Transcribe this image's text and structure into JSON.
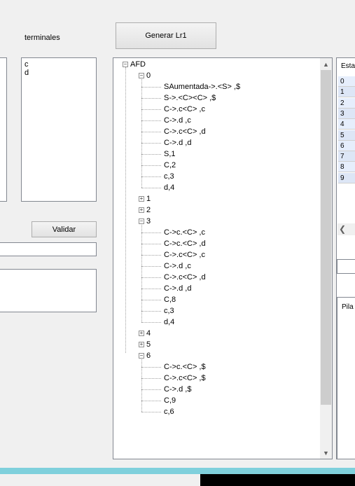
{
  "terminales_label": "terminales",
  "terminales_list": [
    "c",
    "d"
  ],
  "generar_button": "Generar Lr1",
  "validar_button": "Validar",
  "tree": {
    "root": "AFD",
    "nodes": [
      {
        "label": "0",
        "expanded": true,
        "children": [
          "SAumentada->.<S> ,$",
          "S->.<C><C> ,$",
          "C->.c<C> ,c",
          "C->.d ,c",
          "C->.c<C> ,d",
          "C->.d ,d",
          "S,1",
          "C,2",
          "c,3",
          "d,4"
        ]
      },
      {
        "label": "1",
        "expanded": false,
        "children": []
      },
      {
        "label": "2",
        "expanded": false,
        "children": []
      },
      {
        "label": "3",
        "expanded": true,
        "children": [
          "C->c.<C> ,c",
          "C->c.<C> ,d",
          "C->.c<C> ,c",
          "C->.d ,c",
          "C->.c<C> ,d",
          "C->.d ,d",
          "C,8",
          "c,3",
          "d,4"
        ]
      },
      {
        "label": "4",
        "expanded": false,
        "children": []
      },
      {
        "label": "5",
        "expanded": false,
        "children": []
      },
      {
        "label": "6",
        "expanded": true,
        "children": [
          "C->c.<C> ,$",
          "C->.c<C> ,$",
          "C->.d ,$",
          "C,9",
          "c,6"
        ]
      }
    ]
  },
  "grid": {
    "header": "Esta",
    "rows": [
      "0",
      "1",
      "2",
      "3",
      "4",
      "5",
      "6",
      "7",
      "8",
      "9"
    ]
  },
  "pila_label": "Pila",
  "icons": {
    "expand": "plus-box-icon",
    "collapse": "minus-box-icon",
    "scroll_up": "chevron-up-icon",
    "scroll_down": "chevron-down-icon",
    "scroll_left": "chevron-left-icon"
  },
  "colors": {
    "taskbar_accent": "#7fd0dc",
    "grid_selected": "#e6eefc"
  }
}
